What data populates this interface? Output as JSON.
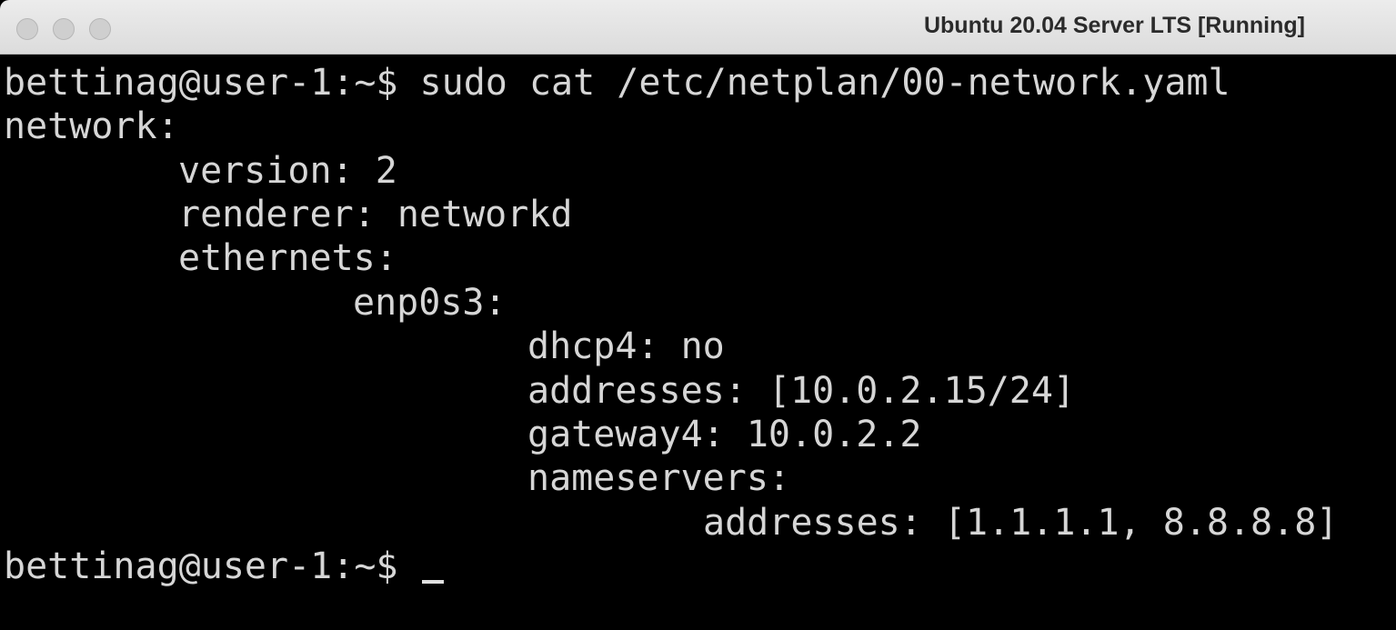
{
  "window": {
    "title": "Ubuntu 20.04 Server LTS [Running]",
    "traffic_lights": [
      "close",
      "minimize",
      "zoom"
    ]
  },
  "terminal": {
    "lines": [
      "bettinag@user-1:~$ sudo cat /etc/netplan/00-network.yaml",
      "network:",
      "version: 2",
      "renderer: networkd",
      "ethernets:",
      "enp0s3:",
      "dhcp4: no",
      "addresses: [10.0.2.15/24]",
      "gateway4: 10.0.2.2",
      "nameservers:",
      "addresses: [1.1.1.1, 8.8.8.8]"
    ],
    "prompt": "bettinag@user-1:~$ ",
    "colors": {
      "background": "#000000",
      "text": "#d6d6d6"
    }
  }
}
